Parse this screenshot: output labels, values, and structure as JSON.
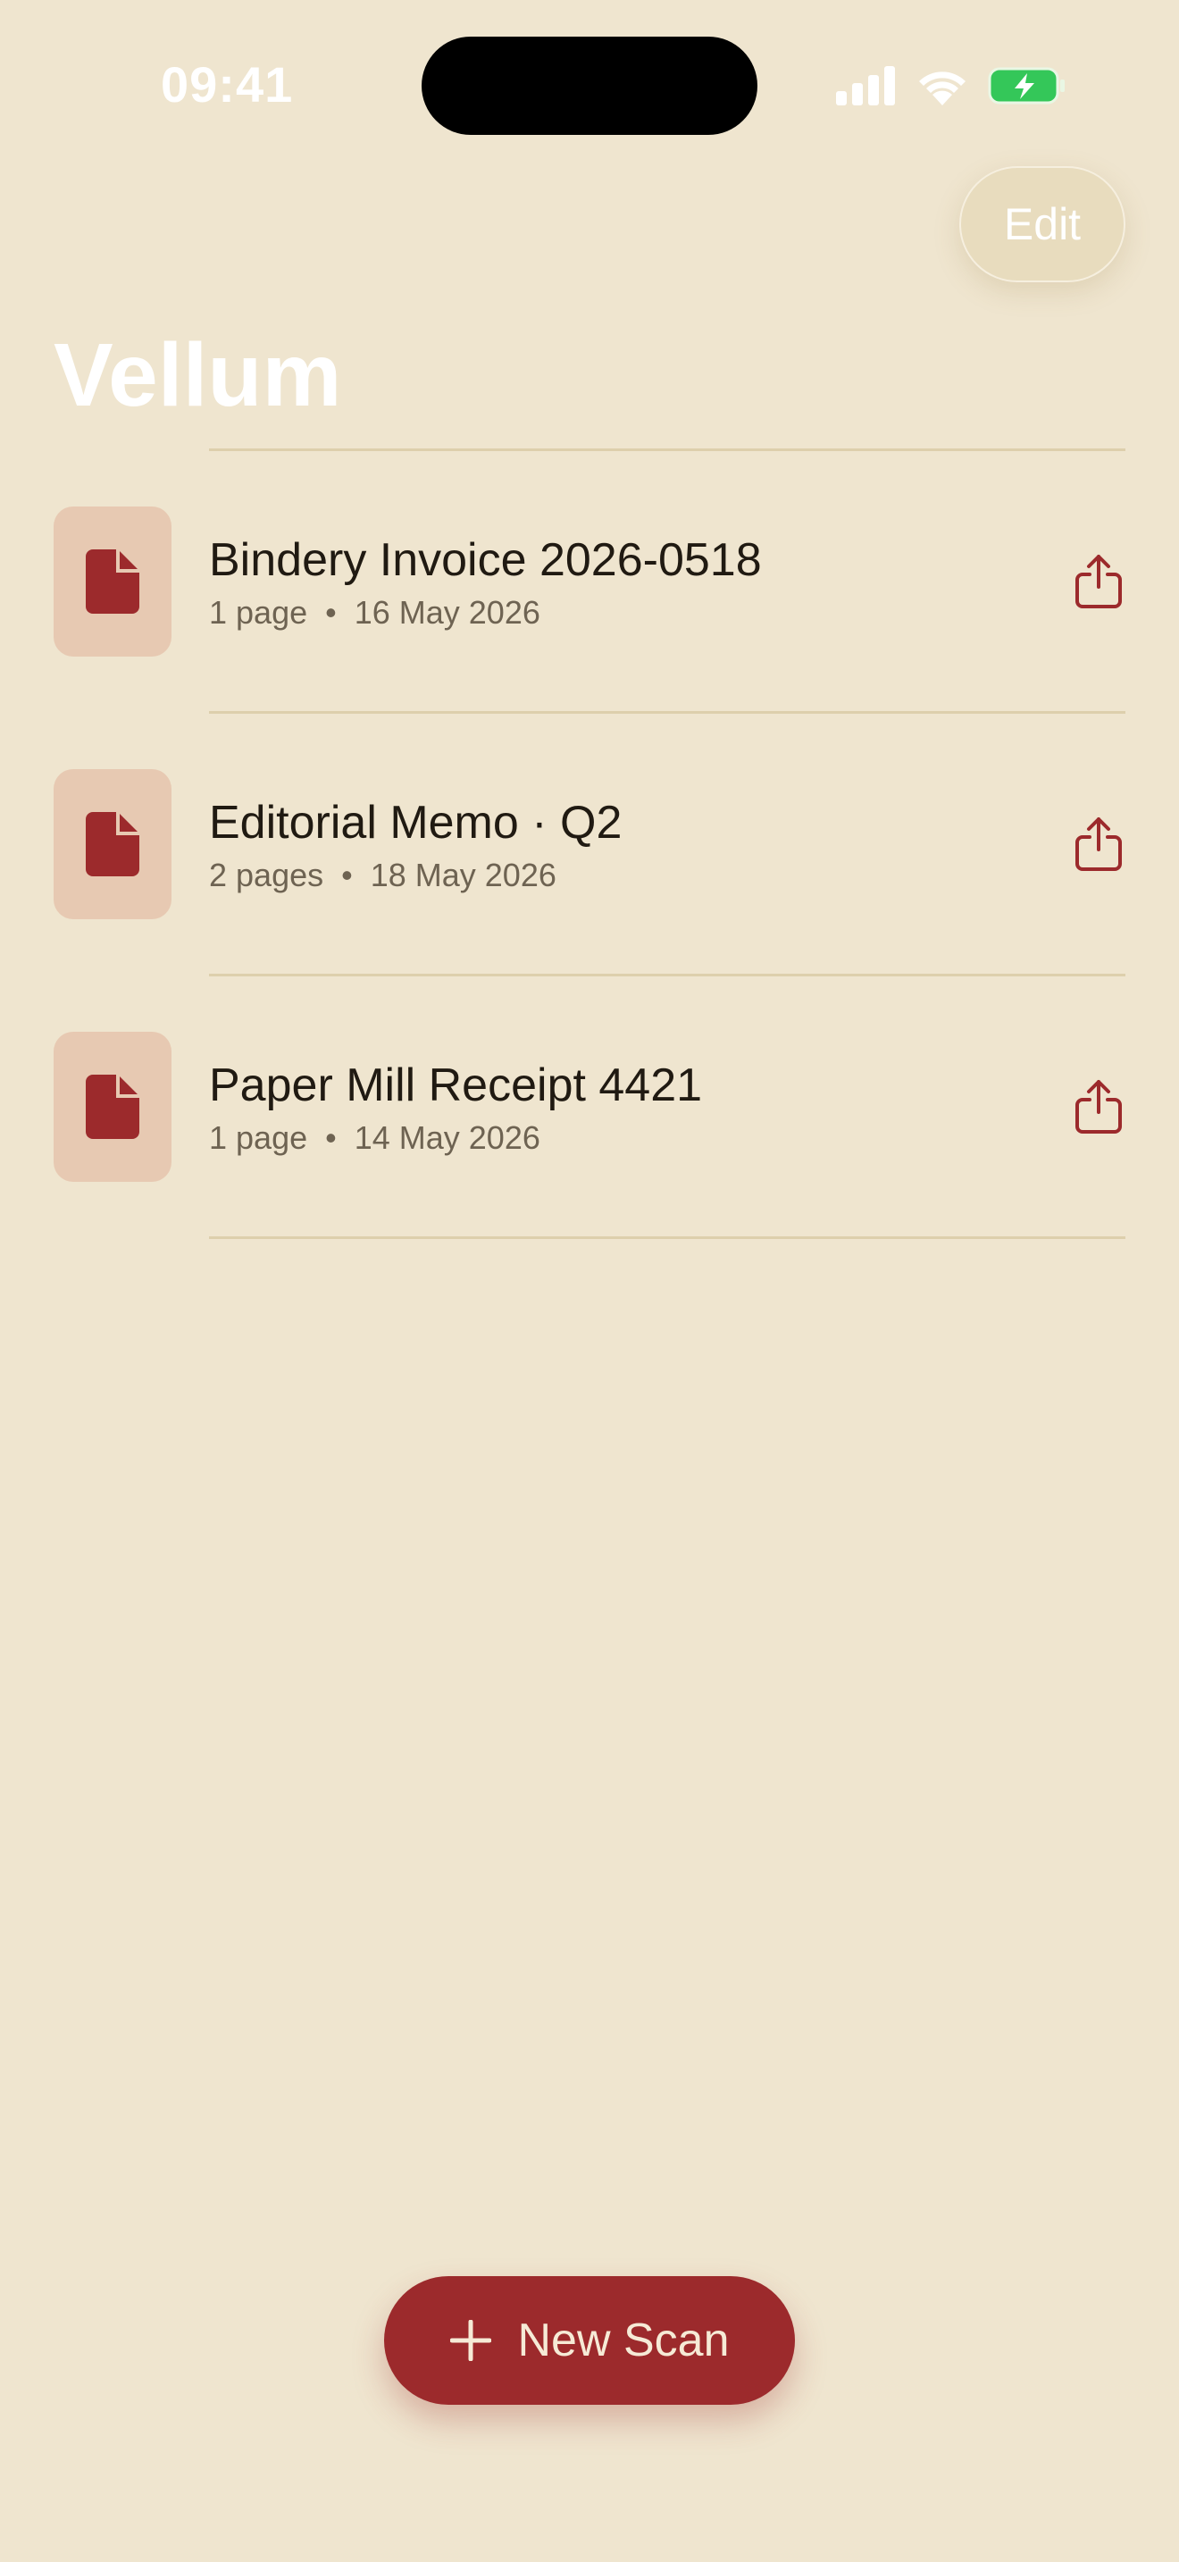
{
  "status_bar": {
    "time": "09:41"
  },
  "header": {
    "edit_label": "Edit",
    "title": "Vellum"
  },
  "documents": [
    {
      "name": "Bindery Invoice 2026-0518",
      "pages": "1 page",
      "date": "16 May 2026"
    },
    {
      "name": "Editorial Memo · Q2",
      "pages": "2 pages",
      "date": "18 May 2026"
    },
    {
      "name": "Paper Mill Receipt 4421",
      "pages": "1 page",
      "date": "14 May 2026"
    }
  ],
  "meta_separator": "•",
  "new_scan": {
    "label": "New Scan",
    "icon": "plus-icon"
  },
  "colors": {
    "background": "#efe5cf",
    "accent": "#9c2a2c",
    "thumb_bg": "#e7c9b2",
    "divider": "#ddcfac",
    "battery_green": "#34c759"
  },
  "icons": {
    "signal": "signal-icon",
    "wifi": "wifi-icon",
    "battery": "battery-charging-icon",
    "document": "document-icon",
    "share": "share-icon"
  }
}
